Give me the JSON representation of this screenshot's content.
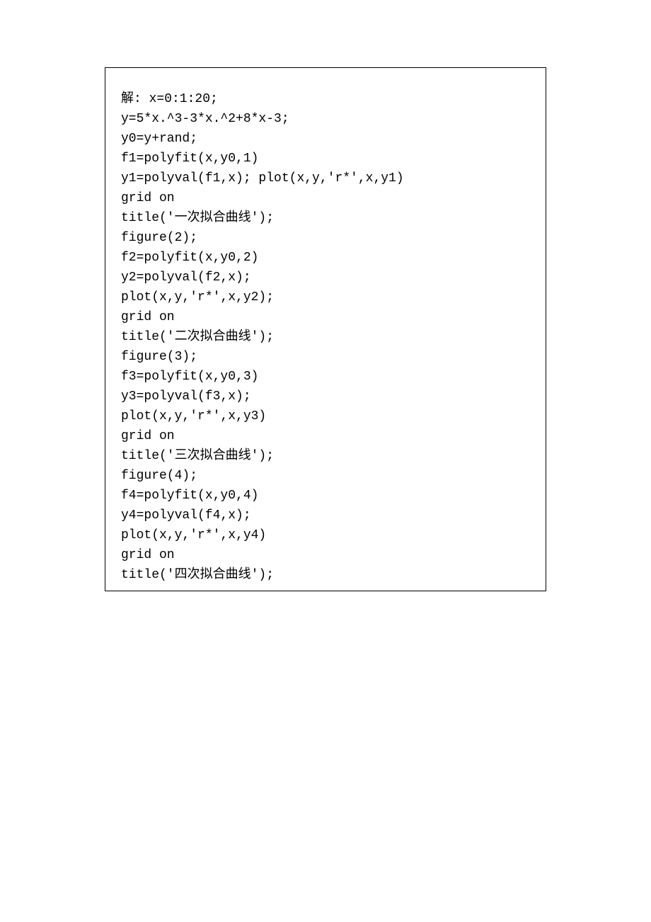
{
  "code": {
    "lines": [
      "解: x=0:1:20;",
      "y=5*x.^3-3*x.^2+8*x-3;",
      "y0=y+rand;",
      "f1=polyfit(x,y0,1)",
      "y1=polyval(f1,x); plot(x,y,'r*',x,y1)",
      "grid on",
      "title('一次拟合曲线');",
      "figure(2);",
      "f2=polyfit(x,y0,2)",
      "y2=polyval(f2,x);",
      "plot(x,y,'r*',x,y2);",
      "grid on",
      "title('二次拟合曲线');",
      "figure(3);",
      "f3=polyfit(x,y0,3)",
      "y3=polyval(f3,x);",
      "plot(x,y,'r*',x,y3)",
      "grid on",
      "title('三次拟合曲线');",
      "figure(4);",
      "f4=polyfit(x,y0,4)",
      "y4=polyval(f4,x);",
      "plot(x,y,'r*',x,y4)",
      "grid on",
      "title('四次拟合曲线');"
    ]
  }
}
